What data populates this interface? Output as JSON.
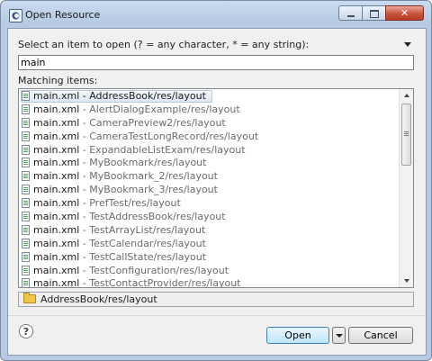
{
  "window": {
    "title": "Open Resource"
  },
  "dialog": {
    "prompt": "Select an item to open (? = any character, * = any string):",
    "search_value": "main",
    "matching_label": "Matching items:",
    "items": [
      {
        "name": "main.xml",
        "path": " - AddressBook/res/layout",
        "selected": true
      },
      {
        "name": "main.xml",
        "path": " - AlertDialogExample/res/layout"
      },
      {
        "name": "main.xml",
        "path": " - CameraPreview2/res/layout"
      },
      {
        "name": "main.xml",
        "path": " - CameraTestLongRecord/res/layout"
      },
      {
        "name": "main.xml",
        "path": " - ExpandableListExam/res/layout"
      },
      {
        "name": "main.xml",
        "path": " - MyBookmark/res/layout"
      },
      {
        "name": "main.xml",
        "path": " - MyBookmark_2/res/layout"
      },
      {
        "name": "main.xml",
        "path": " - MyBookmark_3/res/layout"
      },
      {
        "name": "main.xml",
        "path": " - PrefTest/res/layout"
      },
      {
        "name": "main.xml",
        "path": " - TestAddressBook/res/layout"
      },
      {
        "name": "main.xml",
        "path": " - TestArrayList/res/layout"
      },
      {
        "name": "main.xml",
        "path": " - TestCalendar/res/layout"
      },
      {
        "name": "main.xml",
        "path": " - TestCallState/res/layout"
      },
      {
        "name": "main.xml",
        "path": " - TestConfiguration/res/layout"
      },
      {
        "name": "main.xml",
        "path": " - TestContactProvider/res/layout"
      }
    ],
    "status_path": "AddressBook/res/layout"
  },
  "buttons": {
    "help": "?",
    "open": "Open",
    "cancel": "Cancel"
  },
  "icons": {
    "window": "eclipse-app-icon",
    "menu": "view-menu-triangle-icon",
    "file": "xml-file-icon",
    "folder": "folder-icon",
    "help": "help-icon",
    "dropdown": "chevron-down-icon"
  },
  "colors": {
    "titlebar": "#b6cbe3",
    "close_button": "#c8523c",
    "open_button": "#bee6fd",
    "selection": "#dde7f3"
  }
}
